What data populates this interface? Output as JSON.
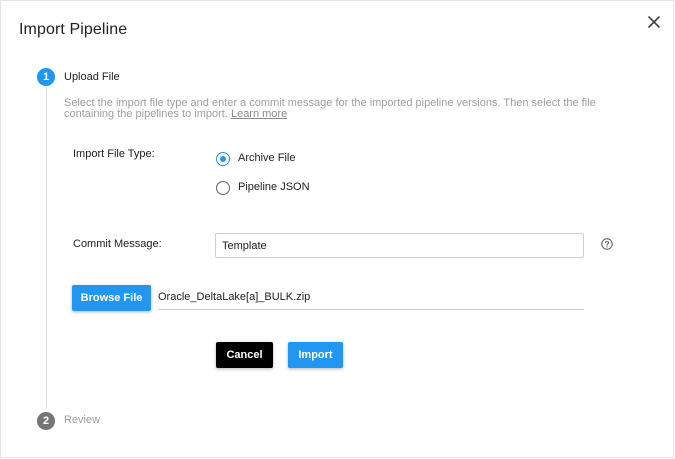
{
  "dialog": {
    "title": "Import Pipeline",
    "close_icon": "close-icon"
  },
  "steps": [
    {
      "number": "1",
      "label": "Upload File",
      "state": "active",
      "color": "#2196f3"
    },
    {
      "number": "2",
      "label": "Review",
      "state": "inactive",
      "color": "#757575"
    }
  ],
  "upload": {
    "description": "Select the import file type and enter a commit message for the imported pipeline versions. Then select the file containing the pipelines to import.",
    "learn_more": "Learn more",
    "file_type_label": "Import File Type:",
    "file_type_options": [
      {
        "label": "Archive File",
        "selected": true
      },
      {
        "label": "Pipeline JSON",
        "selected": false
      }
    ],
    "commit_label": "Commit Message:",
    "commit_value": "Template",
    "help_icon": "help-circle-icon",
    "browse_label": "Browse File",
    "file_name": "Oracle_DeltaLake[a]_BULK.zip"
  },
  "actions": {
    "cancel_label": "Cancel",
    "import_label": "Import"
  },
  "colors": {
    "accent": "#2196f3",
    "cancel_bg": "#000000",
    "muted_text": "#9e9e9e"
  }
}
